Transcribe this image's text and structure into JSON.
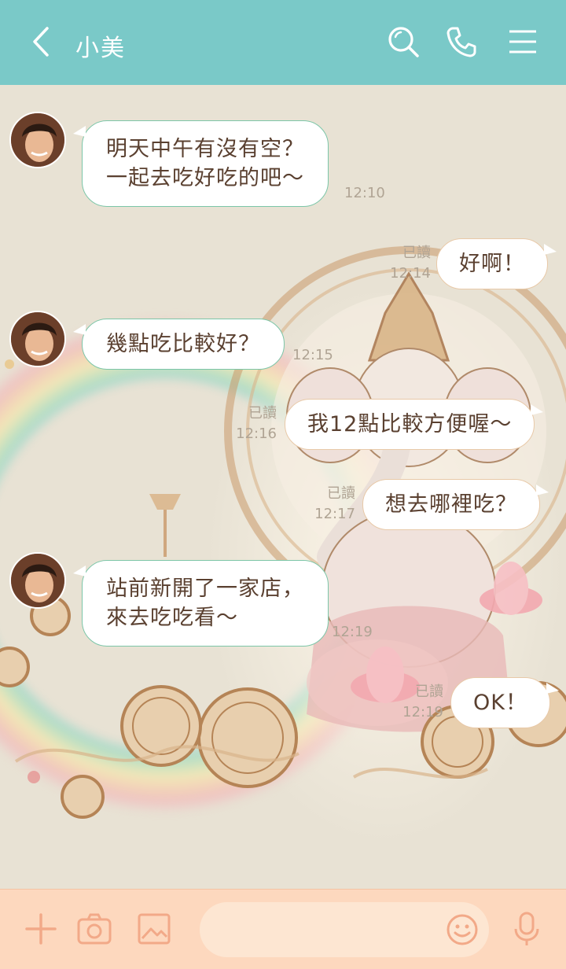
{
  "header": {
    "title": "小美"
  },
  "messages": [
    {
      "text": "明天中午有沒有空？\n一起去吃好吃的吧～",
      "time": "12:10"
    },
    {
      "text": "好啊！",
      "read": "已讀",
      "time": "12:14"
    },
    {
      "text": "幾點吃比較好？",
      "time": "12:15"
    },
    {
      "text": "我12點比較方便喔～",
      "read": "已讀",
      "time": "12:16"
    },
    {
      "text": "想去哪裡吃？",
      "read": "已讀",
      "time": "12:17"
    },
    {
      "text": "站前新開了一家店，\n來去吃吃看～",
      "time": "12:19"
    },
    {
      "text": "OK！",
      "read": "已讀",
      "time": "12:19"
    }
  ],
  "icons": {
    "back": "chevron-left-icon",
    "search": "search-icon",
    "call": "phone-icon",
    "menu": "menu-icon",
    "add": "plus-icon",
    "camera": "camera-icon",
    "image": "image-icon",
    "emoji": "emoji-icon",
    "mic": "mic-icon"
  },
  "colors": {
    "header": "#7ac9c8",
    "input_bar": "#fdd8be",
    "incoming_border": "#7cc6a8"
  }
}
